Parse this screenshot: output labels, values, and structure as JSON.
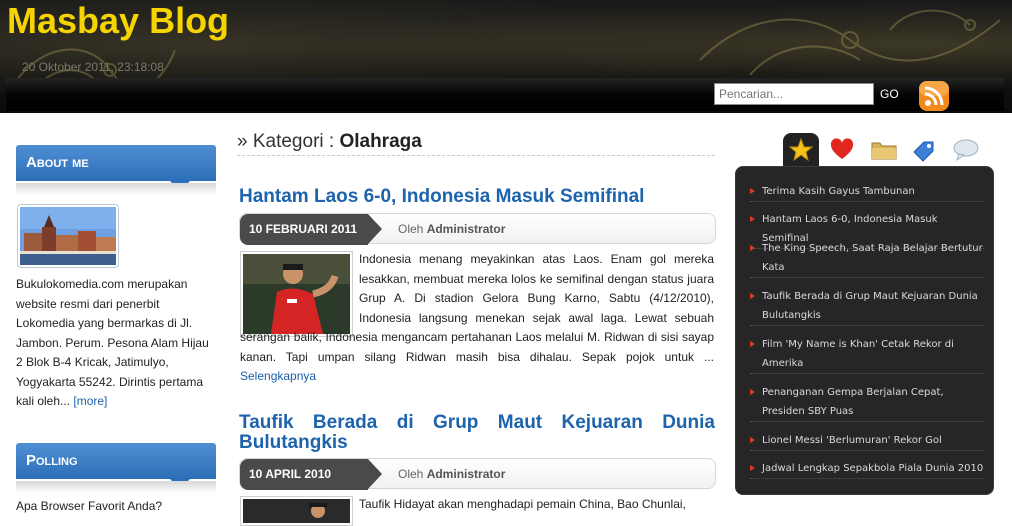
{
  "site": {
    "title": "Masbay Blog",
    "date": "20 Oktober 2011, 23:18:08"
  },
  "search": {
    "placeholder": "Pencarian...",
    "go_label": "GO"
  },
  "sidebar": {
    "about_heading": "About me",
    "about_text": "Bukulokomedia.com merupakan website resmi dari penerbit Lokomedia yang bermarkas di Jl. Jambon. Perum. Pesona Alam Hijau 2 Blok B-4 Kricak, Jatimulyo, Yogyakarta 55242. Dirintis pertama kali oleh...",
    "about_more": "[more]",
    "polling_heading": "Polling",
    "polling_question": "Apa Browser Favorit Anda?"
  },
  "category": {
    "prefix": "» Kategori : ",
    "name": "Olahraga"
  },
  "posts": [
    {
      "title": "Hantam Laos 6-0, Indonesia Masuk Semifinal",
      "date": "10 FEBRUARI 2011",
      "author_prefix": "Oleh ",
      "author": "Administrator",
      "excerpt": "Indonesia menang meyakinkan atas Laos. Enam gol mereka lesakkan, membuat mereka lolos ke semifinal dengan status juara Grup A. Di stadion Gelora Bung Karno, Sabtu (4/12/2010), Indonesia langsung menekan sejak awal laga. Lewat sebuah serangan balik, Indonesia mengancam pertahanan Laos melalui M. Ridwan di sisi sayap kanan. Tapi umpan silang Ridwan masih bisa dihalau. Sepak pojok untuk ... ",
      "more": "Selengkapnya"
    },
    {
      "title": "Taufik Berada di Grup Maut Kejuaran Dunia Bulutangkis",
      "date": "10 APRIL 2010",
      "author_prefix": "Oleh ",
      "author": "Administrator",
      "excerpt": "Taufik Hidayat akan menghadapi pemain China, Bao Chunlai,"
    }
  ],
  "widget": {
    "tabs": [
      "star-icon",
      "heart-icon",
      "folder-icon",
      "tag-icon",
      "comment-icon"
    ],
    "active_tab": 0,
    "links": [
      "Terima Kasih Gayus Tambunan",
      "Hantam Laos 6-0, Indonesia Masuk Semifinal",
      "The King Speech, Saat Raja Belajar Bertutur Kata",
      "Taufik Berada di Grup Maut Kejuaran Dunia Bulutangkis",
      "Film 'My Name is Khan' Cetak Rekor di Amerika",
      "Penanganan Gempa Berjalan Cepat, Presiden SBY Puas",
      "Lionel Messi 'Berlumuran' Rekor Gol",
      "Jadwal Lengkap Sepakbola Piala Dunia 2010"
    ]
  },
  "colors": {
    "title_yellow": "#f5d400",
    "link_blue": "#1d63ad",
    "box_blue": "#2c6fb8",
    "widget_bg": "#262626",
    "bullet_red": "#d93b2b"
  }
}
